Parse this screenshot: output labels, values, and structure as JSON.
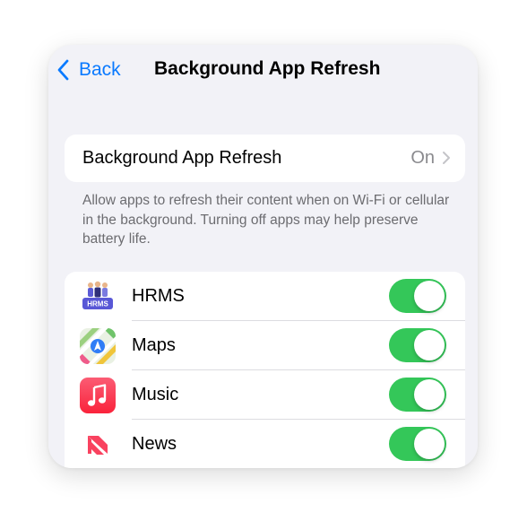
{
  "nav": {
    "back_label": "Back",
    "title": "Background App Refresh"
  },
  "refresh_setting": {
    "label": "Background App Refresh",
    "value": "On"
  },
  "footnote": "Allow apps to refresh their content when on Wi-Fi or cellular in the background. Turning off apps may help preserve battery life.",
  "apps": [
    {
      "name": "HRMS",
      "icon": "hrms-icon",
      "enabled": true,
      "icon_text": "HRMS"
    },
    {
      "name": "Maps",
      "icon": "maps-icon",
      "enabled": true
    },
    {
      "name": "Music",
      "icon": "music-icon",
      "enabled": true
    },
    {
      "name": "News",
      "icon": "news-icon",
      "enabled": true
    }
  ],
  "colors": {
    "accent": "#0a7aff",
    "toggle_on": "#34c759",
    "background": "#f2f2f7"
  }
}
